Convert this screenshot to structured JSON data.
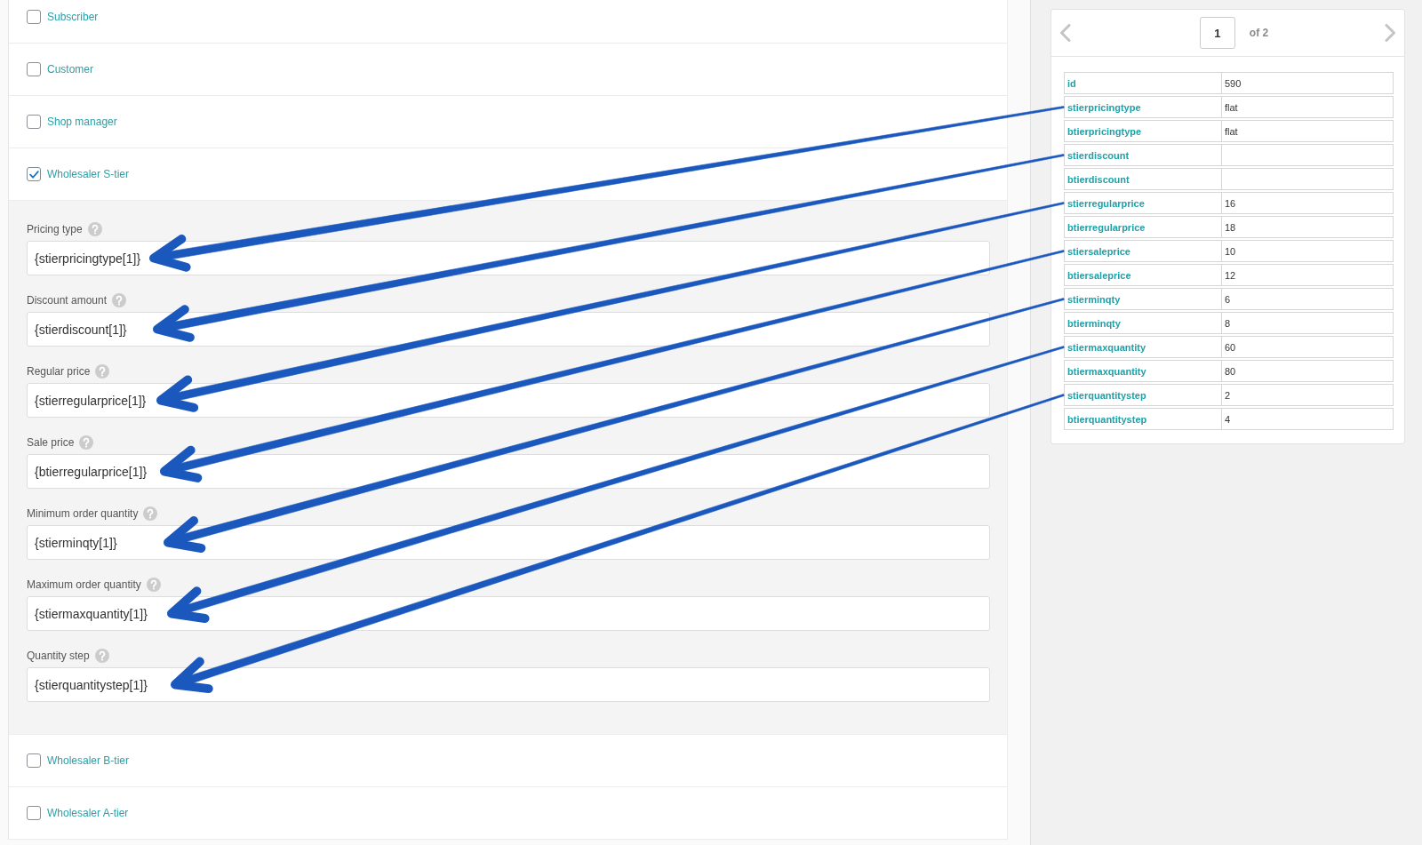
{
  "roles": [
    {
      "label": "Subscriber",
      "checked": false
    },
    {
      "label": "Customer",
      "checked": false
    },
    {
      "label": "Shop manager",
      "checked": false
    },
    {
      "label": "Wholesaler S-tier",
      "checked": true,
      "fields": [
        {
          "label": "Pricing type",
          "value": "{stierpricingtype[1]}"
        },
        {
          "label": "Discount amount",
          "value": "{stierdiscount[1]}"
        },
        {
          "label": "Regular price",
          "value": "{stierregularprice[1]}"
        },
        {
          "label": "Sale price",
          "value": "{btierregularprice[1]}"
        },
        {
          "label": "Minimum order quantity",
          "value": "{stierminqty[1]}"
        },
        {
          "label": "Maximum order quantity",
          "value": "{stiermaxquantity[1]}"
        },
        {
          "label": "Quantity step",
          "value": "{stierquantitystep[1]}"
        }
      ]
    },
    {
      "label": "Wholesaler B-tier",
      "checked": false
    },
    {
      "label": "Wholesaler A-tier",
      "checked": false
    }
  ],
  "record_viewer": {
    "page_input": "1",
    "page_count": "of 2",
    "rows": [
      {
        "key": "id",
        "value": "590",
        "arrow": false
      },
      {
        "key": "stierpricingtype",
        "value": "flat",
        "arrow": true
      },
      {
        "key": "btierpricingtype",
        "value": "flat",
        "arrow": false
      },
      {
        "key": "stierdiscount",
        "arrow": true
      },
      {
        "key": "btierdiscount",
        "arrow": false
      },
      {
        "key": "stierregularprice",
        "value": "16",
        "arrow": true
      },
      {
        "key": "btierregularprice",
        "value": "18",
        "arrow": false
      },
      {
        "key": "stiersaleprice",
        "value": "10",
        "arrow": true
      },
      {
        "key": "btiersaleprice",
        "value": "12",
        "arrow": false
      },
      {
        "key": "stierminqty",
        "value": "6",
        "arrow": true
      },
      {
        "key": "btierminqty",
        "value": "8",
        "arrow": false
      },
      {
        "key": "stiermaxquantity",
        "value": "60",
        "arrow": true
      },
      {
        "key": "btiermaxquantity",
        "value": "80",
        "arrow": false
      },
      {
        "key": "stierquantitystep",
        "value": "2",
        "arrow": true
      },
      {
        "key": "btierquantitystep",
        "value": "4",
        "arrow": false
      }
    ]
  }
}
